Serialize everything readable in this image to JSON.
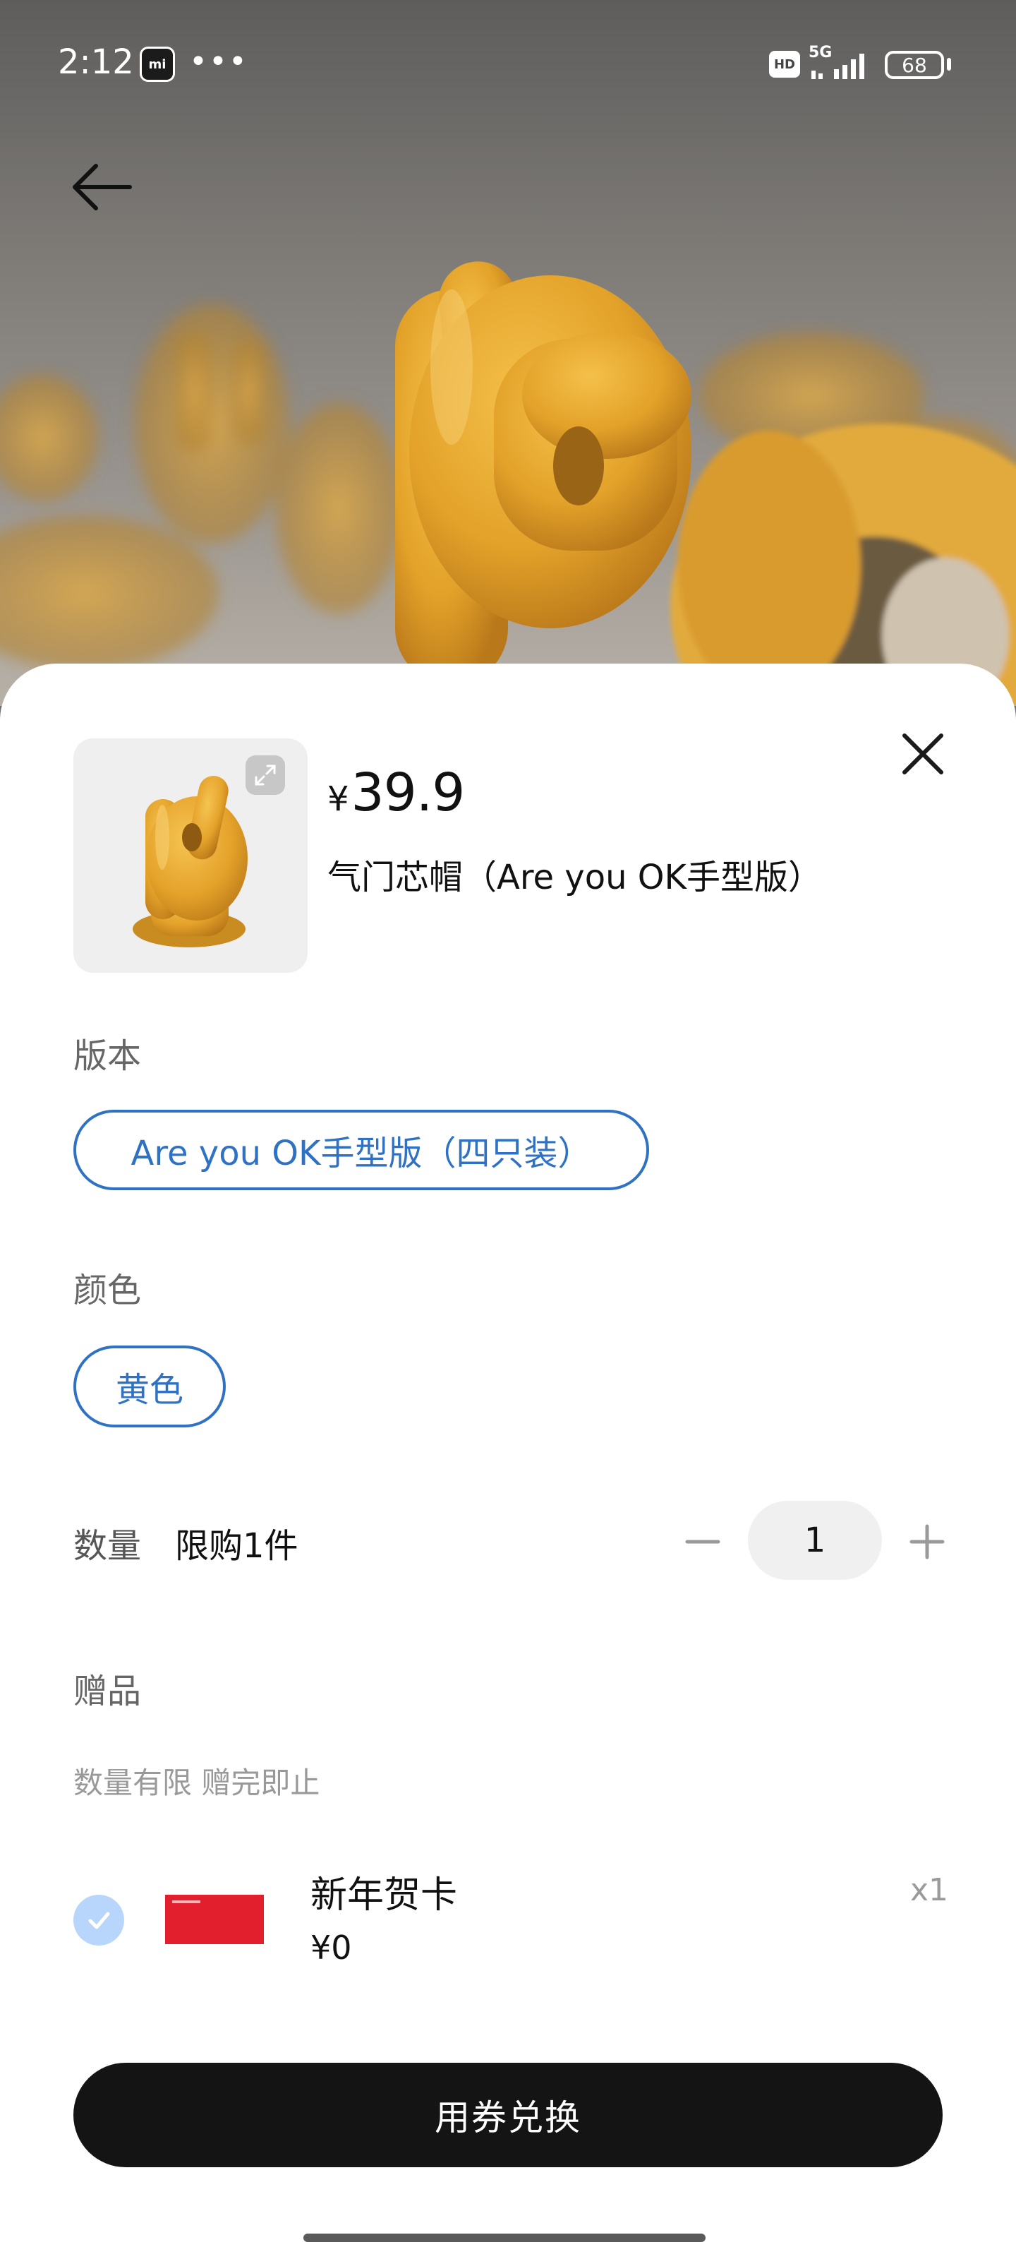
{
  "status_bar": {
    "time": "2:12",
    "app_icon": "mi-icon",
    "more": "•••",
    "hd": "HD",
    "network": "5G",
    "battery": "68"
  },
  "header": {
    "back_icon": "arrow-left-icon"
  },
  "product": {
    "currency": "¥",
    "price": "39.9",
    "name": "气门芯帽（Are you OK手型版）"
  },
  "version": {
    "label": "版本",
    "options": [
      {
        "label": "Are you OK手型版（四只装）",
        "selected": true
      }
    ]
  },
  "color": {
    "label": "颜色",
    "options": [
      {
        "label": "黄色",
        "selected": true
      }
    ]
  },
  "quantity": {
    "label": "数量",
    "limit": "限购1件",
    "value": "1"
  },
  "gift": {
    "label": "赠品",
    "note": "数量有限 赠完即止",
    "items": [
      {
        "name": "新年贺卡",
        "price": "¥0",
        "qty": "x1",
        "checked": true
      }
    ]
  },
  "cta": {
    "label": "用券兑换"
  },
  "colors": {
    "accent": "#2f72c4",
    "button_bg": "#141414",
    "check_bg": "#b8d5fb",
    "card_red": "#e21f2c"
  }
}
